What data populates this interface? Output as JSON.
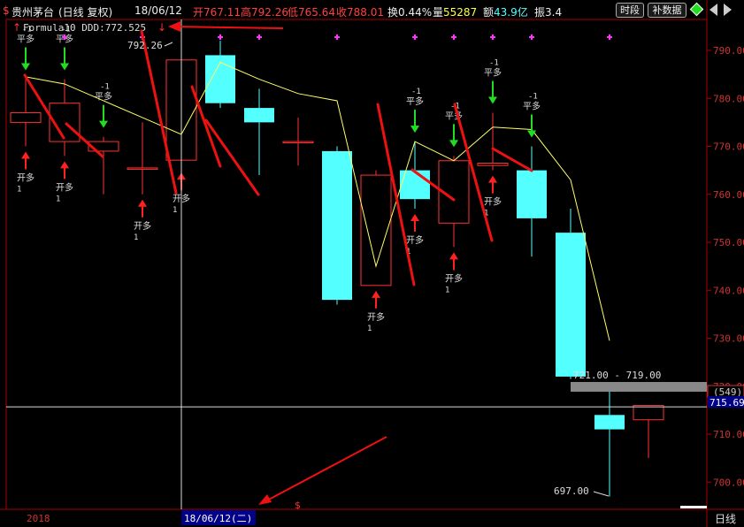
{
  "header": {
    "dollar": "$",
    "stock": "贵州茅台",
    "period": "(日线 复权)",
    "date": "18/06/12",
    "open_label": "开",
    "open": "767.11",
    "high_label": "高",
    "high": "792.26",
    "low_label": "低",
    "low": "765.64",
    "close_label": "收",
    "close": "788.01",
    "turnover_label": "换",
    "turnover": "0.44%",
    "volume_label": "量",
    "volume": "55287",
    "amount_label": "额",
    "amount": "43.9亿",
    "amplitude_label": "振",
    "amplitude": "3.4",
    "btn_intraday": "时段",
    "btn_fill": "补数据"
  },
  "formula": {
    "text": "Formula10 DDD:772.525"
  },
  "price_axis": {
    "ticks": [
      "790.00",
      "780.00",
      "770.00",
      "760.00",
      "750.00",
      "740.00",
      "730.00",
      "720.00",
      "710.00",
      "700.00"
    ],
    "current": "715.69",
    "gap_count": "(549)"
  },
  "annotations": {
    "high_label": "792.26",
    "gap_range": "721.00 - 719.00",
    "low_label": "697.00"
  },
  "signals": {
    "open_long": "开多",
    "close_long": "平多",
    "one": "1",
    "minus_one": "-1"
  },
  "bottom": {
    "year": "2018",
    "cursor_date": "18/06/12(二)",
    "dollar": "$",
    "period": "日线"
  },
  "colors": {
    "up": "#ff3232",
    "down": "#54ffff",
    "ma": "#ffff66",
    "grid": "#aa0000",
    "axis_text": "#cc3333",
    "signal_up": "#ff2020",
    "signal_down": "#22dd22",
    "marker": "#ff33ff"
  },
  "chart_data": {
    "type": "candlestick",
    "y_range": [
      695,
      796
    ],
    "candles": [
      {
        "o": 775.0,
        "h": 784.0,
        "l": 770.0,
        "c": 777.0
      },
      {
        "o": 771.0,
        "h": 784.0,
        "l": 768.0,
        "c": 779.0
      },
      {
        "o": 769.0,
        "h": 772.0,
        "l": 760.0,
        "c": 771.0
      },
      {
        "o": 765.5,
        "h": 775.0,
        "l": 760.0,
        "c": 765.5
      },
      {
        "o": 767.11,
        "h": 792.26,
        "l": 765.64,
        "c": 788.01
      },
      {
        "o": 789.0,
        "h": 792.0,
        "l": 778.0,
        "c": 779.0
      },
      {
        "o": 778.0,
        "h": 782.0,
        "l": 764.0,
        "c": 775.0
      },
      {
        "o": 771.0,
        "h": 776.0,
        "l": 766.0,
        "c": 771.0
      },
      {
        "o": 769.0,
        "h": 770.0,
        "l": 737.0,
        "c": 738.0
      },
      {
        "o": 741.0,
        "h": 765.0,
        "l": 741.0,
        "c": 764.0
      },
      {
        "o": 765.0,
        "h": 771.0,
        "l": 757.0,
        "c": 759.0
      },
      {
        "o": 754.0,
        "h": 768.0,
        "l": 749.0,
        "c": 767.0
      },
      {
        "o": 766.0,
        "h": 777.0,
        "l": 765.0,
        "c": 766.5
      },
      {
        "o": 765.0,
        "h": 770.0,
        "l": 747.0,
        "c": 755.0
      },
      {
        "o": 752.0,
        "h": 757.0,
        "l": 721.5,
        "c": 722.0
      },
      {
        "o": 714.0,
        "h": 719.0,
        "l": 697.0,
        "c": 711.0
      },
      {
        "o": 713.0,
        "h": 716.0,
        "l": 705.0,
        "c": 716.0
      }
    ],
    "ma": [
      784.5,
      783.0,
      779.5,
      776.0,
      772.5,
      787.5,
      784.0,
      781.0,
      779.5,
      745.0,
      771.0,
      767.0,
      774.0,
      773.5,
      763.0,
      729.5
    ],
    "signals": [
      {
        "i": 0,
        "kind": "close",
        "pos": "above"
      },
      {
        "i": 0,
        "kind": "open",
        "pos": "below"
      },
      {
        "i": 1,
        "kind": "close",
        "pos": "above"
      },
      {
        "i": 1,
        "kind": "open",
        "pos": "below"
      },
      {
        "i": 2,
        "kind": "close",
        "pos": "above"
      },
      {
        "i": 3,
        "kind": "open",
        "pos": "below"
      },
      {
        "i": 4,
        "kind": "open",
        "pos": "below"
      },
      {
        "i": 9,
        "kind": "open",
        "pos": "below"
      },
      {
        "i": 10,
        "kind": "close",
        "pos": "above"
      },
      {
        "i": 10,
        "kind": "open",
        "pos": "below"
      },
      {
        "i": 11,
        "kind": "close",
        "pos": "above"
      },
      {
        "i": 11,
        "kind": "open",
        "pos": "below"
      },
      {
        "i": 12,
        "kind": "close",
        "pos": "above"
      },
      {
        "i": 12,
        "kind": "open",
        "pos": "below"
      },
      {
        "i": 13,
        "kind": "close",
        "pos": "above"
      }
    ],
    "markers": [
      1,
      3,
      5,
      6,
      8,
      10,
      11,
      12,
      13,
      15
    ],
    "current_price": 715.69
  }
}
